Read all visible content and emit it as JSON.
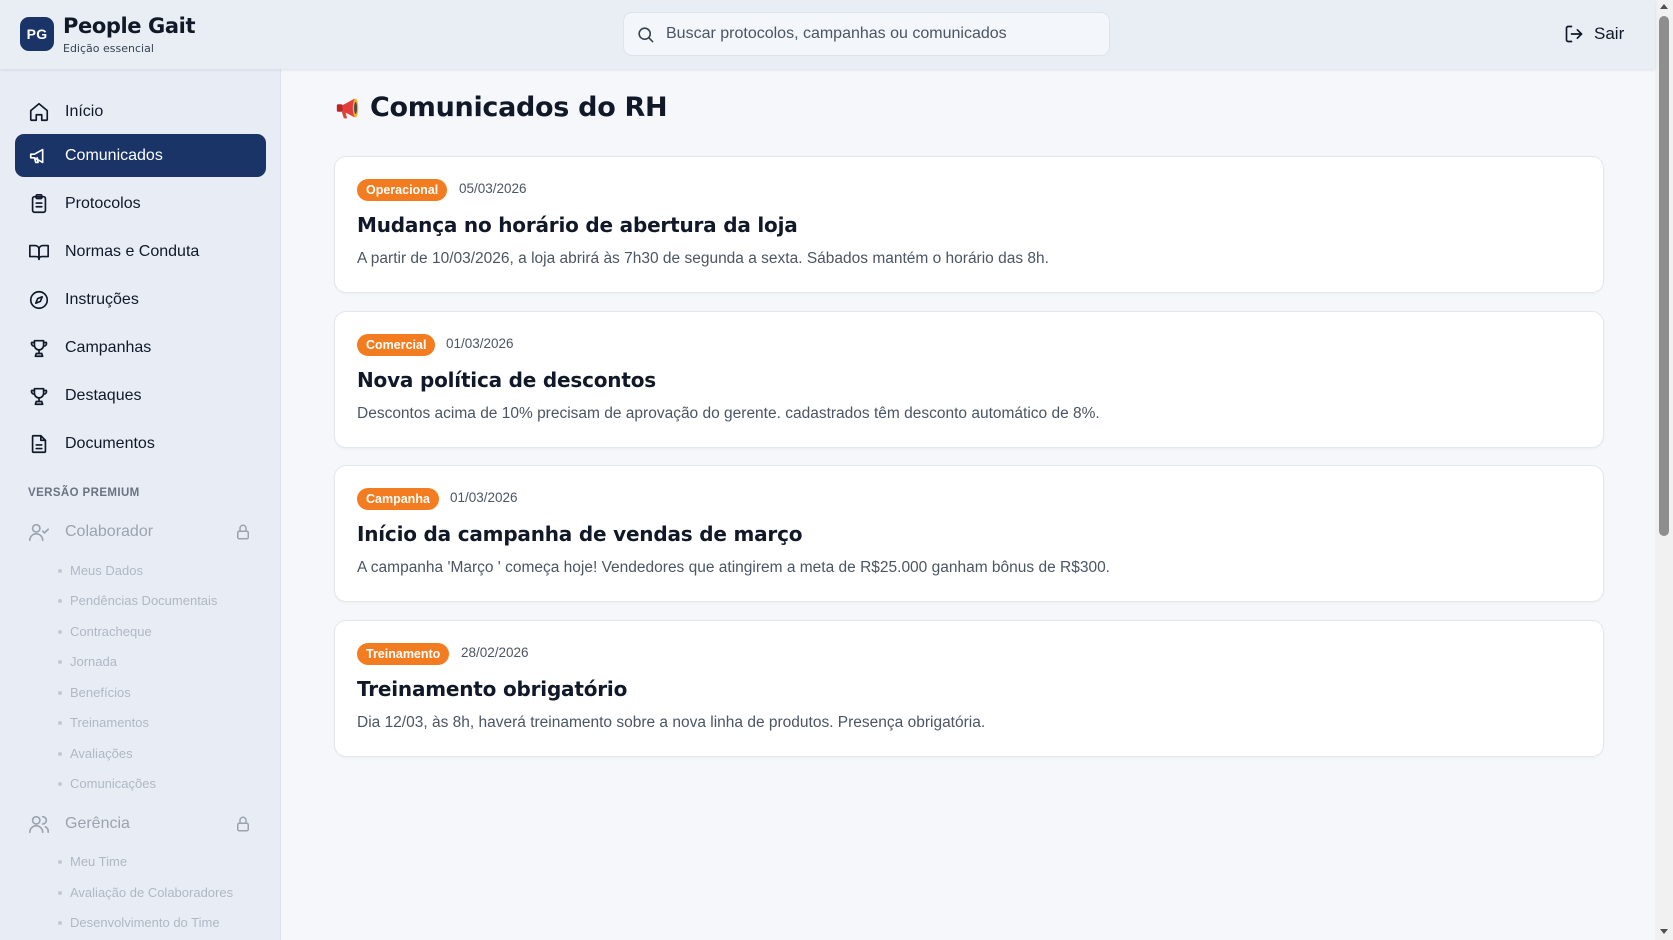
{
  "brand": {
    "initials": "PG",
    "name": "People Gait",
    "edition": "Edição essencial"
  },
  "search": {
    "placeholder": "Buscar protocolos, campanhas ou comunicados"
  },
  "header": {
    "logout_label": "Sair"
  },
  "sidebar": {
    "items": [
      {
        "label": "Início",
        "icon": "home-icon"
      },
      {
        "label": "Comunicados",
        "icon": "megaphone-icon",
        "active": true
      },
      {
        "label": "Protocolos",
        "icon": "clipboard-icon"
      },
      {
        "label": "Normas e Conduta",
        "icon": "book-icon"
      },
      {
        "label": "Instruções",
        "icon": "compass-icon"
      },
      {
        "label": "Campanhas",
        "icon": "trophy-icon"
      },
      {
        "label": "Destaques",
        "icon": "trophy-icon"
      },
      {
        "label": "Documentos",
        "icon": "document-icon"
      }
    ],
    "premium_label": "VERSÃO PREMIUM",
    "premium_groups": [
      {
        "label": "Colaborador",
        "icon": "user-check-icon",
        "subitems": [
          "Meus Dados",
          "Pendências Documentais",
          "Contracheque",
          "Jornada",
          "Benefícios",
          "Treinamentos",
          "Avaliações",
          "Comunicações"
        ]
      },
      {
        "label": "Gerência",
        "icon": "users-icon",
        "subitems": [
          "Meu Time",
          "Avaliação de Colaboradores",
          "Desenvolvimento do Time"
        ]
      }
    ]
  },
  "main": {
    "title": "Comunicados do RH",
    "accent_color": "#f47c20",
    "announcements": [
      {
        "tag": "Operacional",
        "date": "05/03/2026",
        "title": "Mudança no horário de abertura da loja",
        "body": "A partir de 10/03/2026, a loja abrirá às 7h30 de segunda a sexta. Sábados mantém o horário das 8h."
      },
      {
        "tag": "Comercial",
        "date": "01/03/2026",
        "title": "Nova política de descontos",
        "body": "Descontos acima de 10% precisam de aprovação do gerente.  cadastrados têm desconto automático de 8%."
      },
      {
        "tag": "Campanha",
        "date": "01/03/2026",
        "title": "Início da campanha de vendas de março",
        "body": "A campanha 'Março ' começa hoje! Vendedores que atingirem a meta de R$25.000 ganham bônus de R$300."
      },
      {
        "tag": "Treinamento",
        "date": "28/02/2026",
        "title": "Treinamento obrigatório",
        "body": "Dia 12/03, às 8h, haverá treinamento sobre a nova linha de produtos. Presença obrigatória."
      }
    ]
  }
}
